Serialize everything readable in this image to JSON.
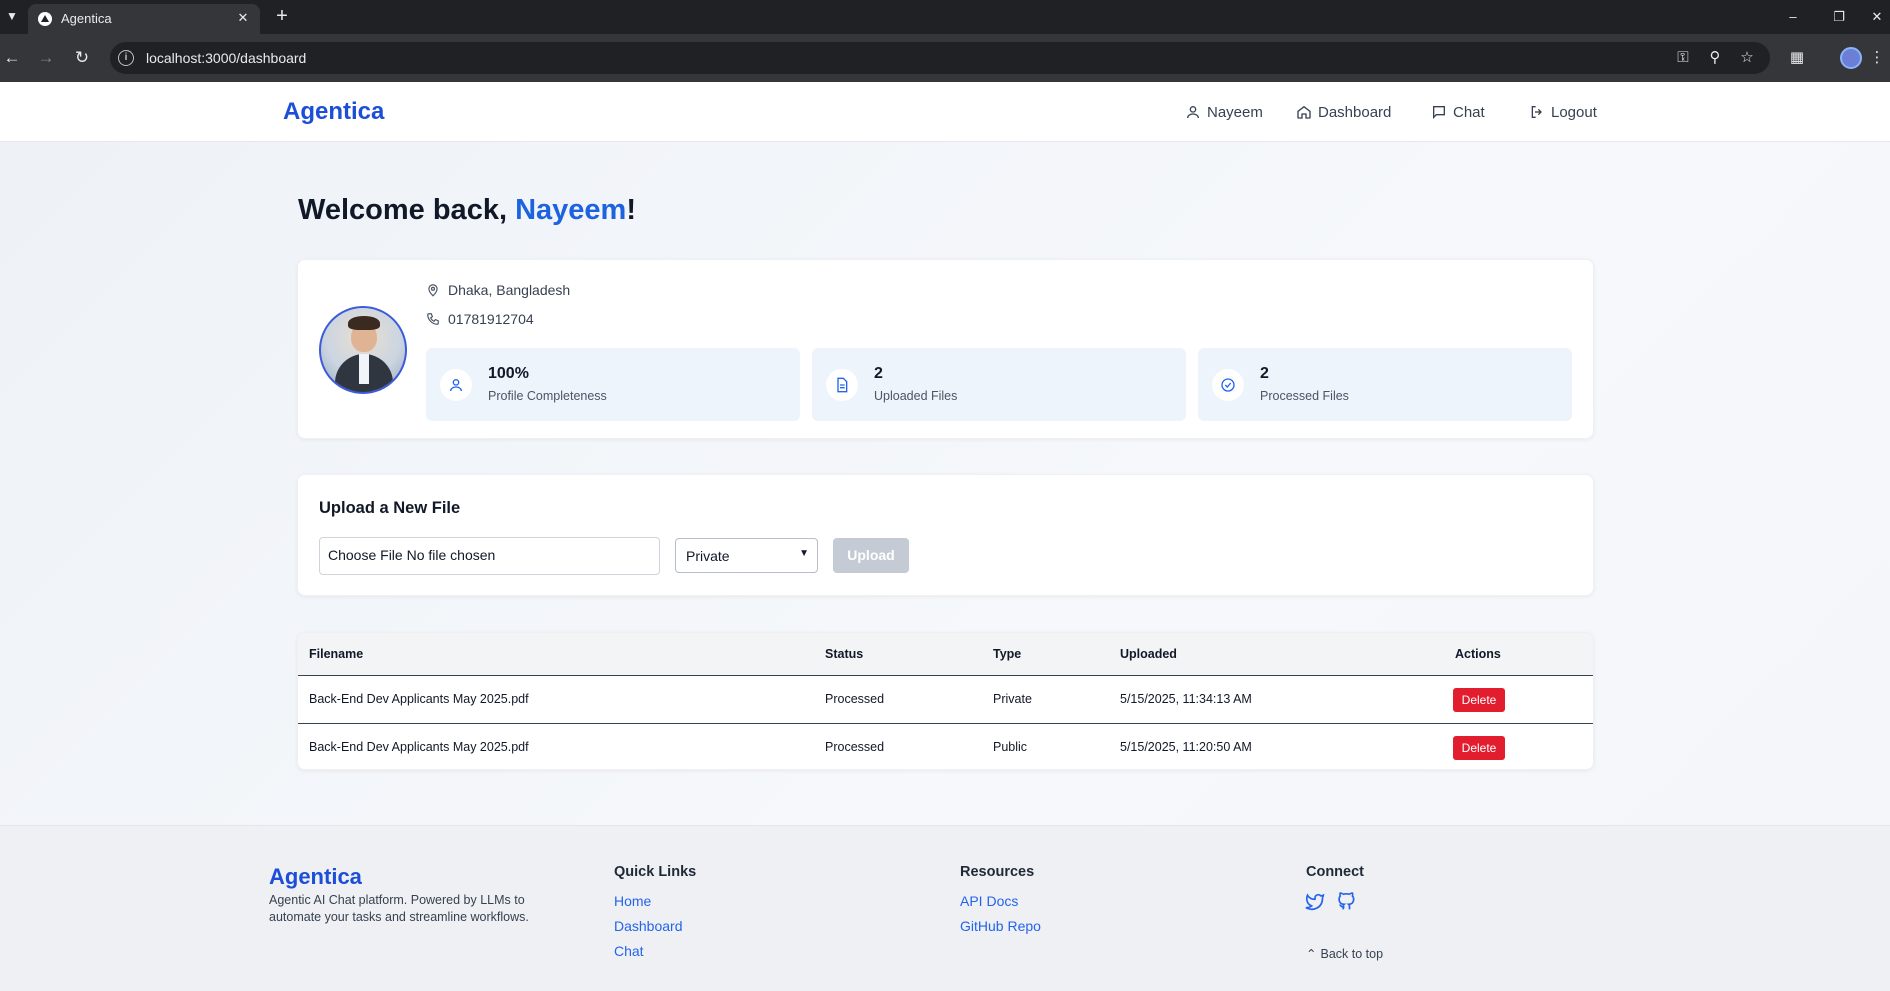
{
  "browser": {
    "tab_title": "Agentica",
    "url": "localhost:3000/dashboard"
  },
  "header": {
    "brand": "Agentica",
    "nav": [
      {
        "label": "Nayeem",
        "icon": "user-icon"
      },
      {
        "label": "Dashboard",
        "icon": "home-icon"
      },
      {
        "label": "Chat",
        "icon": "chat-icon"
      },
      {
        "label": "Logout",
        "icon": "logout-icon"
      }
    ]
  },
  "welcome": {
    "prefix": "Welcome back, ",
    "name": "Nayeem",
    "suffix": "!"
  },
  "profile": {
    "location": "Dhaka, Bangladesh",
    "phone": "01781912704",
    "stats": [
      {
        "value": "100%",
        "label": "Profile Completeness",
        "icon": "user-icon"
      },
      {
        "value": "2",
        "label": "Uploaded Files",
        "icon": "file-icon"
      },
      {
        "value": "2",
        "label": "Processed Files",
        "icon": "check-circle-icon"
      }
    ]
  },
  "upload": {
    "title": "Upload a New File",
    "file_input_text": "Choose File No file chosen",
    "visibility_selected": "Private",
    "upload_label": "Upload"
  },
  "files_table": {
    "columns": [
      "Filename",
      "Status",
      "Type",
      "Uploaded",
      "Actions"
    ],
    "rows": [
      {
        "filename": "Back-End Dev Applicants May 2025.pdf",
        "status": "Processed",
        "type": "Private",
        "uploaded": "5/15/2025, 11:34:13 AM",
        "action": "Delete"
      },
      {
        "filename": "Back-End Dev Applicants May 2025.pdf",
        "status": "Processed",
        "type": "Public",
        "uploaded": "5/15/2025, 11:20:50 AM",
        "action": "Delete"
      }
    ]
  },
  "footer": {
    "brand": "Agentica",
    "description": "Agentic AI Chat platform. Powered by LLMs to automate your tasks and streamline workflows.",
    "quick_links_title": "Quick Links",
    "quick_links": [
      "Home",
      "Dashboard",
      "Chat"
    ],
    "resources_title": "Resources",
    "resources": [
      "API Docs",
      "GitHub Repo"
    ],
    "connect_title": "Connect",
    "social": [
      "twitter-icon",
      "github-icon"
    ],
    "back_to_top": "Back to top"
  },
  "colors": {
    "brand_blue": "#1d4ed8",
    "highlight_blue": "#1d63e0",
    "delete_red": "#e11d2e",
    "stat_bg": "#eef4fc"
  }
}
